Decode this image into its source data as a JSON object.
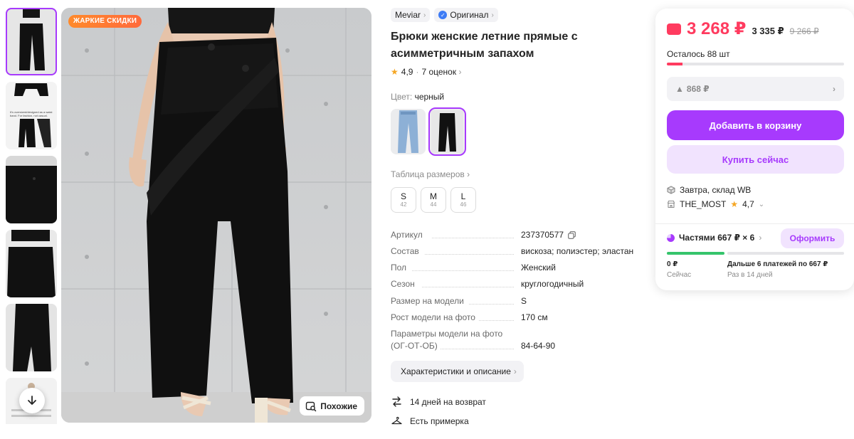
{
  "gallery": {
    "thumb_caption": "It's oversized/designed as a waist band.\nFor fashion, not casual.",
    "promo_badge": "ЖАРКИЕ СКИДКИ",
    "similar_label": "Похожие"
  },
  "product": {
    "brand": "Meviar",
    "original_label": "Оригинал",
    "title": "Брюки женские летние прямые с асимметричным запахом",
    "rating": "4,9",
    "reviews": "7 оценок",
    "color_label": "Цвет:",
    "color_value": "черный",
    "size_table_label": "Таблица размеров",
    "sizes": [
      {
        "label": "S",
        "ru": "42"
      },
      {
        "label": "M",
        "ru": "44"
      },
      {
        "label": "L",
        "ru": "46"
      }
    ],
    "params": [
      {
        "key": "Артикул",
        "value": "237370577"
      },
      {
        "key": "Состав",
        "value": "вискоза; полиэстер; эластан"
      },
      {
        "key": "Пол",
        "value": "Женский"
      },
      {
        "key": "Сезон",
        "value": "круглогодичный"
      },
      {
        "key": "Размер на модели",
        "value": "S"
      },
      {
        "key": "Рост модели на фото",
        "value": "170 см"
      },
      {
        "key": "Параметры модели на фото",
        "key2": "(ОГ-ОТ-ОБ)",
        "value": "84-64-90"
      }
    ],
    "characteristics_button": "Характеристики и описание",
    "perks": [
      {
        "icon": "return-icon",
        "label": "14 дней на возврат"
      },
      {
        "icon": "hanger-icon",
        "label": "Есть примерка"
      }
    ]
  },
  "price_card": {
    "price": "3 268 ₽",
    "price_without_wallet": "3 335 ₽",
    "price_old": "9 266 ₽",
    "stock_label": "Осталось 88 шт",
    "stock_fraction": 0.09,
    "points": "868 ₽",
    "add_to_cart": "Добавить в корзину",
    "buy_now": "Купить сейчас",
    "delivery": "Завтра, склад WB",
    "seller_name": "THE_MOST",
    "seller_rating": "4,7",
    "installments": "Частями 667 ₽ × 6",
    "order_button": "Оформить",
    "plan_now_amount": "0 ₽",
    "plan_now_label": "Сейчас",
    "plan_later_amount": "Дальше 6 платежей по 667 ₽",
    "plan_later_label": "Раз в 14 дней"
  },
  "colors": {
    "accent": "#a73afd",
    "price_red": "#ff3b5f",
    "promo_orange": "#ff7a2f",
    "plan_green": "#35c46b"
  }
}
